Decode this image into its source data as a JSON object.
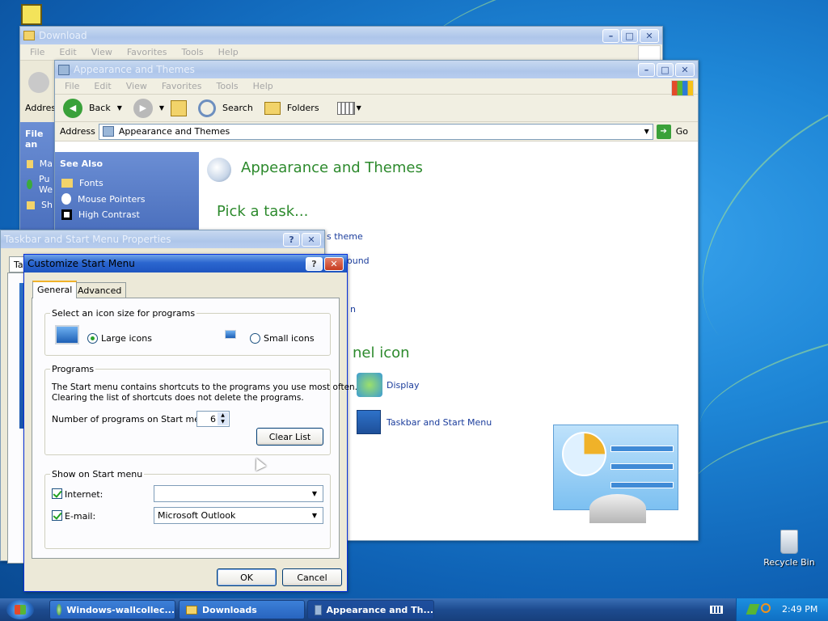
{
  "desktop": {
    "recycle_bin": "Recycle Bin"
  },
  "windows": {
    "downloads": {
      "title": "Download",
      "menu": [
        "File",
        "Edit",
        "View",
        "Favorites",
        "Tools",
        "Help"
      ],
      "address": "Addres",
      "side_header": "File an",
      "side_items": [
        "Ma",
        "Pu We",
        "Sh"
      ]
    },
    "appearance": {
      "title": "Appearance and Themes",
      "menu": [
        "File",
        "Edit",
        "View",
        "Favorites",
        "Tools",
        "Help"
      ],
      "toolbar": {
        "back": "Back",
        "search": "Search",
        "folders": "Folders"
      },
      "address_label": "Address",
      "address_value": "Appearance and Themes",
      "go": "Go",
      "see_also": "See Also",
      "see_also_items": [
        "Fonts",
        "Mouse Pointers",
        "High Contrast"
      ],
      "heading": "Appearance and Themes",
      "pick_task": "Pick a task...",
      "tasks_partial": [
        "s theme",
        "ound",
        "n"
      ],
      "panel_icon_heading": "nel icon",
      "panel_icons": [
        "Display",
        "Taskbar and Start Menu"
      ]
    },
    "taskbar_props": {
      "title": "Taskbar and Start Menu Properties",
      "tab_fragment": "Ta"
    },
    "customize": {
      "title": "Customize Start Menu",
      "tabs": [
        "General",
        "Advanced"
      ],
      "icon_size_group": "Select an icon size for programs",
      "large_icons": "Large icons",
      "small_icons": "Small icons",
      "programs_group": "Programs",
      "programs_desc1": "The Start menu contains shortcuts to the programs you use most often.",
      "programs_desc2": "Clearing the list of shortcuts does not delete the programs.",
      "num_programs_label": "Number of programs on Start menu:",
      "num_programs_value": "6",
      "clear_list": "Clear List",
      "show_group": "Show on Start menu",
      "internet_label": "Internet:",
      "internet_value": "",
      "email_label": "E-mail:",
      "email_value": "Microsoft Outlook",
      "ok": "OK",
      "cancel": "Cancel"
    }
  },
  "taskbar": {
    "buttons": [
      "Windows-wallcollec...",
      "Downloads",
      "Appearance and Th..."
    ],
    "clock": "2:49 PM"
  },
  "colors": {
    "xp_blue": "#245edb",
    "green_heading": "#2d8a2d",
    "link": "#1b3d9c"
  }
}
